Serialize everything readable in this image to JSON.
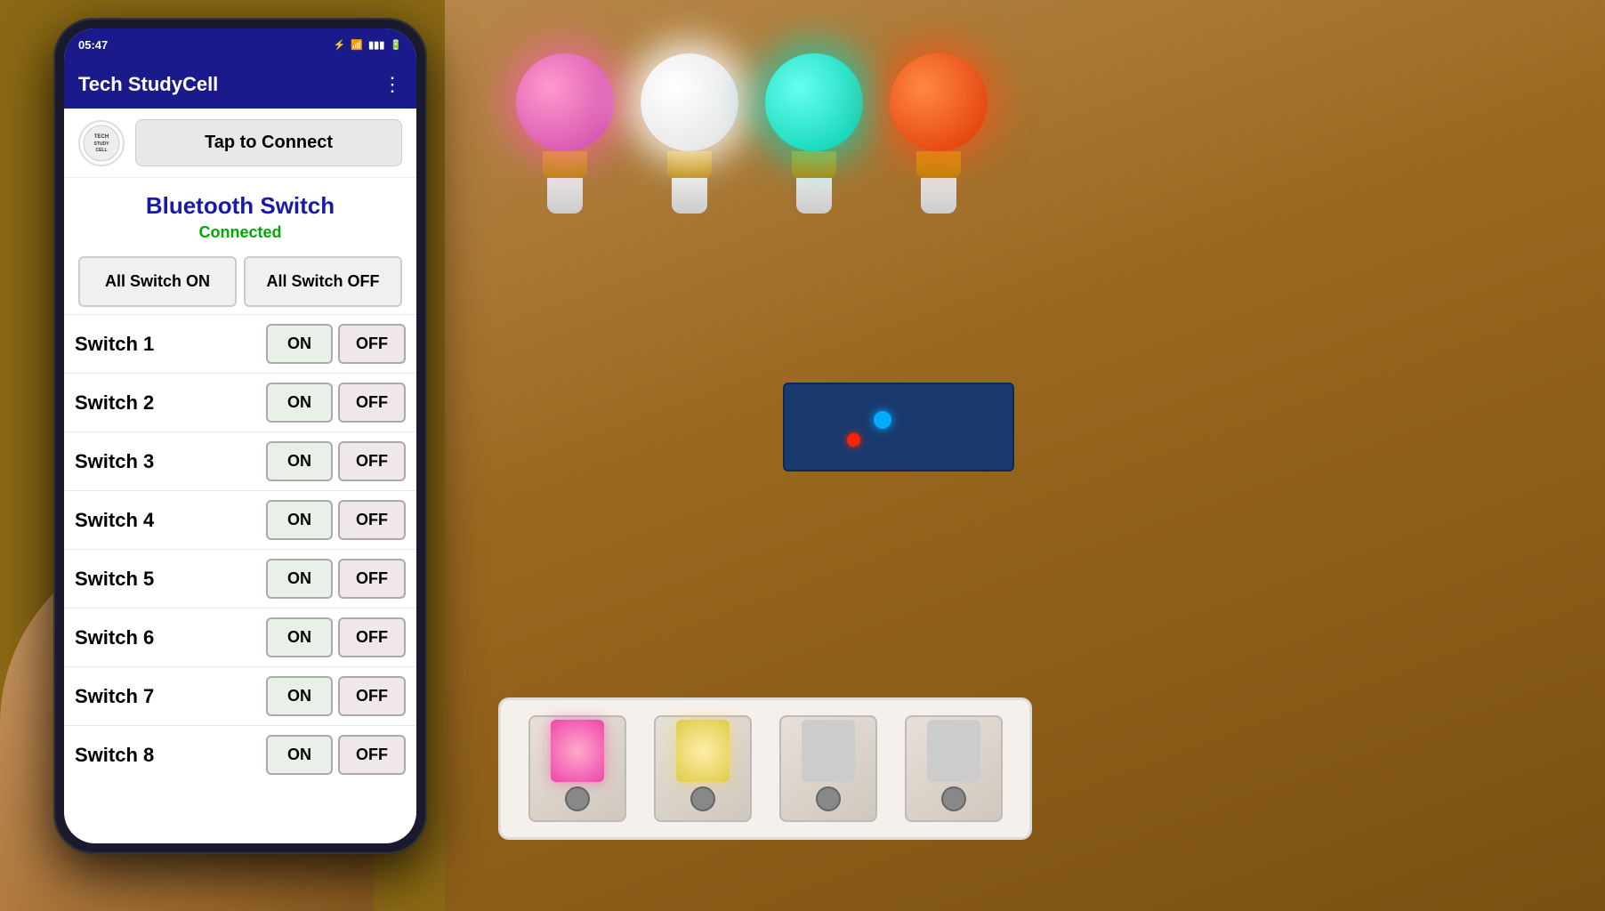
{
  "scene": {
    "background_color": "#8B6010"
  },
  "phone": {
    "status_bar": {
      "time": "05:47",
      "icons": [
        "bluetooth",
        "wifi",
        "signal",
        "battery"
      ]
    },
    "app_bar": {
      "title": "Tech StudyCell",
      "menu_label": "⋮"
    },
    "connect_section": {
      "logo_text": "STUDY\nCELL",
      "connect_button_label": "Tap to Connect"
    },
    "bluetooth_section": {
      "title": "Bluetooth Switch",
      "status": "Connected"
    },
    "all_switch_row": {
      "on_label": "All Switch ON",
      "off_label": "All Switch OFF"
    },
    "switches": [
      {
        "label": "Switch 1",
        "on": "ON",
        "off": "OFF"
      },
      {
        "label": "Switch 2",
        "on": "ON",
        "off": "OFF"
      },
      {
        "label": "Switch 3",
        "on": "ON",
        "off": "OFF"
      },
      {
        "label": "Switch 4",
        "on": "ON",
        "off": "OFF"
      },
      {
        "label": "Switch 5",
        "on": "ON",
        "off": "OFF"
      },
      {
        "label": "Switch 6",
        "on": "ON",
        "off": "OFF"
      },
      {
        "label": "Switch 7",
        "on": "ON",
        "off": "OFF"
      },
      {
        "label": "Switch 8",
        "on": "ON",
        "off": "OFF"
      }
    ]
  },
  "bulbs": [
    {
      "color": "pink",
      "label": "Pink bulb"
    },
    {
      "color": "white",
      "label": "White bulb"
    },
    {
      "color": "cyan",
      "label": "Cyan bulb"
    },
    {
      "color": "orange",
      "label": "Orange bulb"
    }
  ]
}
